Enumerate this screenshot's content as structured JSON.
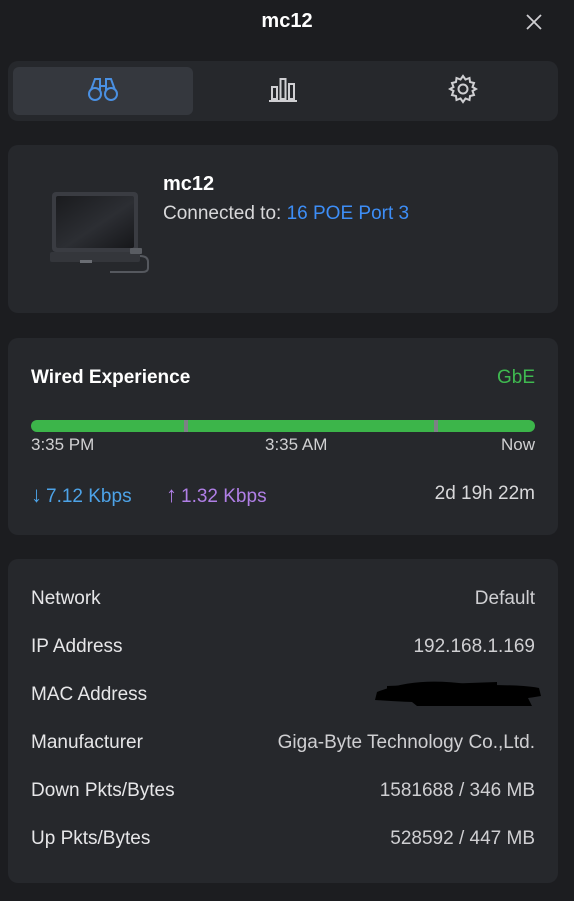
{
  "header": {
    "title": "mc12"
  },
  "tabs": [
    {
      "name": "overview",
      "icon": "binoculars-icon",
      "active": true
    },
    {
      "name": "stats",
      "icon": "bar-chart-icon",
      "active": false
    },
    {
      "name": "settings",
      "icon": "gear-icon",
      "active": false
    }
  ],
  "device": {
    "name": "mc12",
    "connected_label": "Connected to:",
    "connected_value": "16 POE Port 3",
    "icon": "laptop-icon"
  },
  "experience": {
    "title": "Wired Experience",
    "grade": "GbE",
    "colors": {
      "good": "#3cb54a",
      "accent_link": "#3d8ef7"
    },
    "timeline": {
      "start": "3:35 PM",
      "mid": "3:35 AM",
      "end": "Now"
    },
    "download": "7.12 Kbps",
    "upload": "1.32 Kbps",
    "uptime": "2d 19h 22m"
  },
  "info": {
    "rows": [
      {
        "key": "Network",
        "value": "Default"
      },
      {
        "key": "IP Address",
        "value": "192.168.1.169"
      },
      {
        "key": "MAC Address",
        "value": ""
      },
      {
        "key": "Manufacturer",
        "value": "Giga-Byte Technology Co.,Ltd."
      },
      {
        "key": "Down Pkts/Bytes",
        "value": "1581688 / 346 MB"
      },
      {
        "key": "Up Pkts/Bytes",
        "value": "528592 / 447 MB"
      }
    ]
  }
}
